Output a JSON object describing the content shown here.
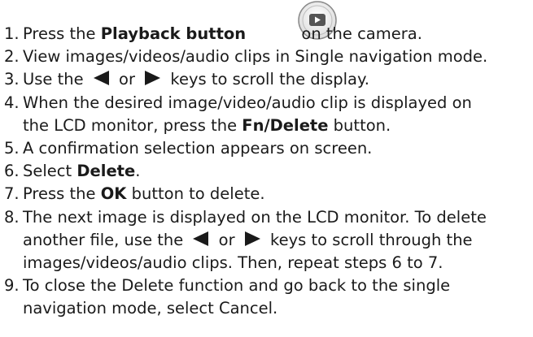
{
  "icons": {
    "playback_button": "playback-button-icon",
    "left_key": "left-arrow-icon",
    "right_key": "right-arrow-icon"
  },
  "steps": [
    {
      "num": "1.",
      "pre": "Press the ",
      "bold": "Playback button",
      "post": " on the camera."
    },
    {
      "num": "2.",
      "text": "View images/videos/audio clips in Single navigation mode."
    },
    {
      "num": "3.",
      "pre": "Use the ",
      "mid": " or ",
      "post": " keys to scroll the display."
    },
    {
      "num": "4.",
      "line1": "When the desired image/video/audio clip is displayed on",
      "line2_pre": "the LCD monitor, press the ",
      "line2_bold": "Fn/Delete",
      "line2_post": " button."
    },
    {
      "num": "5.",
      "text": "A confirmation selection appears on screen."
    },
    {
      "num": "6.",
      "pre": "Select ",
      "bold": "Delete",
      "post": "."
    },
    {
      "num": "7.",
      "pre": "Press the ",
      "bold": "OK",
      "post": " button to delete."
    },
    {
      "num": "8.",
      "line1": "The next image is displayed on the LCD monitor. To delete",
      "line2_pre": "another file, use the ",
      "line2_mid": " or ",
      "line2_post": " keys to scroll through the",
      "line3": "images/videos/audio clips. Then, repeat steps 6 to 7."
    },
    {
      "num": "9.",
      "line1": "To close the Delete function and go back to the single",
      "line2": "navigation mode, select Cancel."
    }
  ]
}
